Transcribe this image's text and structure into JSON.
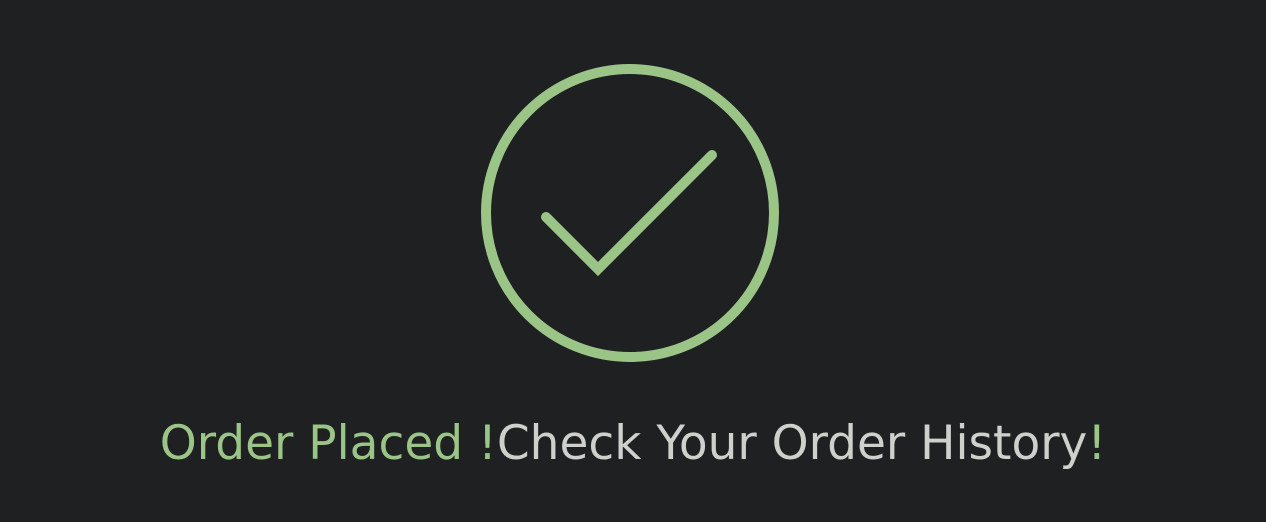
{
  "status": {
    "icon": "check-circle-icon",
    "placed_text": "Order Placed !",
    "history_text": "Check Your Order History",
    "history_bang": "!",
    "accent_color": "#9bc487",
    "text_color": "#cfcfcc",
    "background_color": "#1f2022"
  }
}
